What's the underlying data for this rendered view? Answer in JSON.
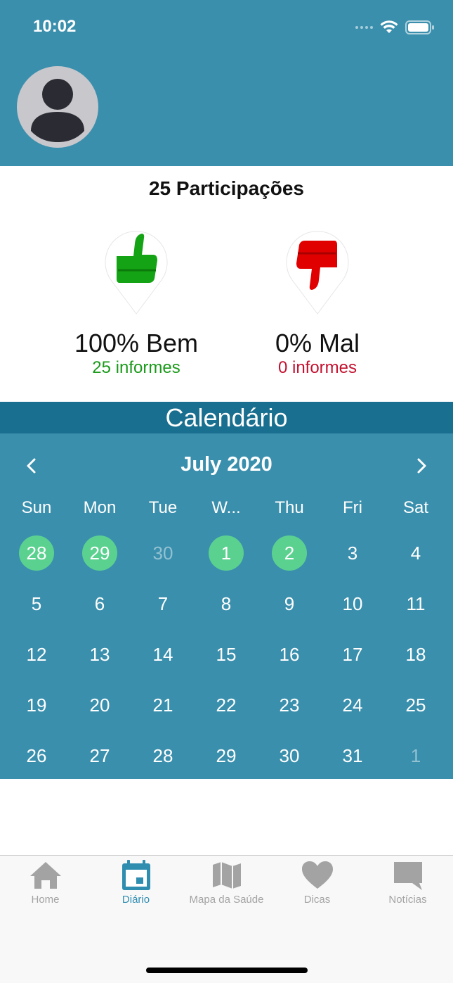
{
  "status_bar": {
    "time": "10:02"
  },
  "summary": {
    "participations": "25 Participações",
    "good": {
      "label": "100% Bem",
      "count": "25 informes",
      "color": "#14a314"
    },
    "bad": {
      "label": "0% Mal",
      "count": "0 informes",
      "color": "#e00000"
    }
  },
  "calendar": {
    "title": "Calendário",
    "month": "July 2020",
    "prev_icon": "chevron-left-icon",
    "next_icon": "chevron-right-icon",
    "weekdays": [
      "Sun",
      "Mon",
      "Tue",
      "W...",
      "Thu",
      "Fri",
      "Sat"
    ],
    "marked_color": "#5bd190",
    "days": [
      {
        "label": "28",
        "marked": true,
        "muted": false
      },
      {
        "label": "29",
        "marked": true,
        "muted": false
      },
      {
        "label": "30",
        "marked": false,
        "muted": true
      },
      {
        "label": "1",
        "marked": true,
        "muted": false
      },
      {
        "label": "2",
        "marked": true,
        "muted": false
      },
      {
        "label": "3",
        "marked": false,
        "muted": false
      },
      {
        "label": "4",
        "marked": false,
        "muted": false
      },
      {
        "label": "5",
        "marked": false,
        "muted": false
      },
      {
        "label": "6",
        "marked": false,
        "muted": false
      },
      {
        "label": "7",
        "marked": false,
        "muted": false
      },
      {
        "label": "8",
        "marked": false,
        "muted": false
      },
      {
        "label": "9",
        "marked": false,
        "muted": false
      },
      {
        "label": "10",
        "marked": false,
        "muted": false
      },
      {
        "label": "11",
        "marked": false,
        "muted": false
      },
      {
        "label": "12",
        "marked": false,
        "muted": false
      },
      {
        "label": "13",
        "marked": false,
        "muted": false
      },
      {
        "label": "14",
        "marked": false,
        "muted": false
      },
      {
        "label": "15",
        "marked": false,
        "muted": false
      },
      {
        "label": "16",
        "marked": false,
        "muted": false
      },
      {
        "label": "17",
        "marked": false,
        "muted": false
      },
      {
        "label": "18",
        "marked": false,
        "muted": false
      },
      {
        "label": "19",
        "marked": false,
        "muted": false
      },
      {
        "label": "20",
        "marked": false,
        "muted": false
      },
      {
        "label": "21",
        "marked": false,
        "muted": false
      },
      {
        "label": "22",
        "marked": false,
        "muted": false
      },
      {
        "label": "23",
        "marked": false,
        "muted": false
      },
      {
        "label": "24",
        "marked": false,
        "muted": false
      },
      {
        "label": "25",
        "marked": false,
        "muted": false
      },
      {
        "label": "26",
        "marked": false,
        "muted": false
      },
      {
        "label": "27",
        "marked": false,
        "muted": false
      },
      {
        "label": "28",
        "marked": false,
        "muted": false
      },
      {
        "label": "29",
        "marked": false,
        "muted": false
      },
      {
        "label": "30",
        "marked": false,
        "muted": false
      },
      {
        "label": "31",
        "marked": false,
        "muted": false
      },
      {
        "label": "1",
        "marked": false,
        "muted": true
      }
    ]
  },
  "tabbar": {
    "active_color": "#2f8db0",
    "inactive_color": "#a3a3a3",
    "tabs": [
      {
        "label": "Home",
        "icon": "home-icon",
        "active": false
      },
      {
        "label": "Diário",
        "icon": "calendar-icon",
        "active": true
      },
      {
        "label": "Mapa da Saúde",
        "icon": "map-icon",
        "active": false
      },
      {
        "label": "Dicas",
        "icon": "heart-icon",
        "active": false
      },
      {
        "label": "Notícias",
        "icon": "chat-bubble-icon",
        "active": false
      }
    ]
  }
}
